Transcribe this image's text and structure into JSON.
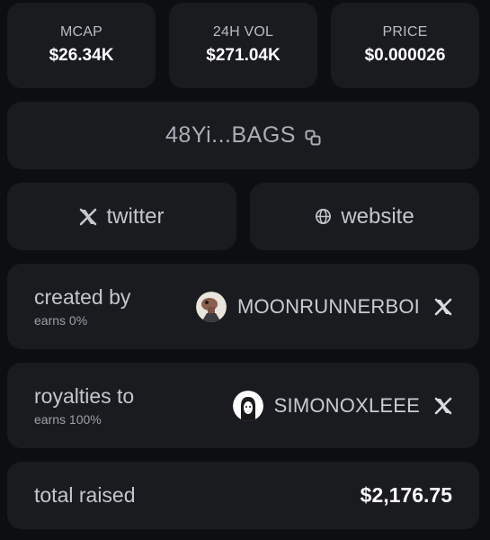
{
  "stats": [
    {
      "label": "MCAP",
      "value": "$26.34K"
    },
    {
      "label": "24H VOL",
      "value": "$271.04K"
    },
    {
      "label": "PRICE",
      "value": "$0.000026"
    }
  ],
  "contract": {
    "address_short": "48Yi...BAGS",
    "copy_icon": "copy-icon"
  },
  "links": {
    "twitter_label": "twitter",
    "twitter_icon": "x-logo-icon",
    "website_label": "website",
    "website_icon": "globe-icon"
  },
  "created_by": {
    "title": "created by",
    "earns": "earns 0%",
    "username": "MOONRUNNERBOI",
    "social_icon": "x-logo-icon"
  },
  "royalties_to": {
    "title": "royalties to",
    "earns": "earns 100%",
    "username": "SIMONOXLEEE",
    "social_icon": "x-logo-icon"
  },
  "total_raised": {
    "title": "total raised",
    "amount": "$2,176.75"
  },
  "colors": {
    "background": "#0d0e10",
    "card": "#191b1f",
    "text_primary": "#ffffff",
    "text_secondary": "#c2c7ce"
  }
}
